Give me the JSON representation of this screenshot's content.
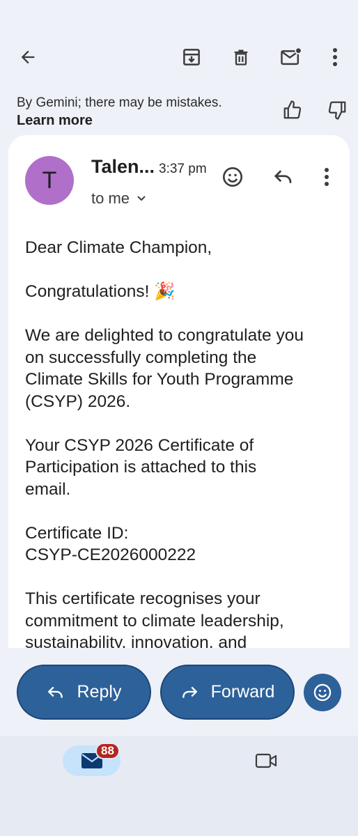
{
  "toolbar": {
    "back_icon": "arrow-back-icon",
    "archive_icon": "archive-icon",
    "delete_icon": "trash-icon",
    "mark_unread_icon": "mail-unread-icon",
    "more_icon": "more-vert-icon"
  },
  "gemini": {
    "disclaimer": "By Gemini; there may be mistakes.",
    "learn_more": "Learn more",
    "thumbs_up_icon": "thumbs-up-icon",
    "thumbs_down_icon": "thumbs-down-icon"
  },
  "message": {
    "avatar_letter": "T",
    "avatar_color": "#b06fc8",
    "sender": "Talen...",
    "time": "3:37 pm",
    "recipient": "to me",
    "body": {
      "greeting": "Dear Climate Champion,",
      "congrats": "Congratulations! 🎉",
      "para1_l1": "We are delighted to congratulate you",
      "para1_l2": "on successfully completing the",
      "para1_l3": "Climate Skills for Youth Programme",
      "para1_l4": "(CSYP) 2026.",
      "para2_l1": "Your CSYP 2026 Certificate of",
      "para2_l2": "Participation is attached to this",
      "para2_l3": "email.",
      "cert_label": "Certificate ID:",
      "cert_id": "CSYP-CE2026000222",
      "para3_l1": "This certificate recognises your",
      "para3_l2": "commitment to climate leadership,",
      "para3_l3": "sustainability, innovation, and"
    }
  },
  "actions": {
    "reply": "Reply",
    "forward": "Forward",
    "accent": "#2d6199"
  },
  "bottom_nav": {
    "mail_badge": "88",
    "badge_color": "#b3261e"
  }
}
